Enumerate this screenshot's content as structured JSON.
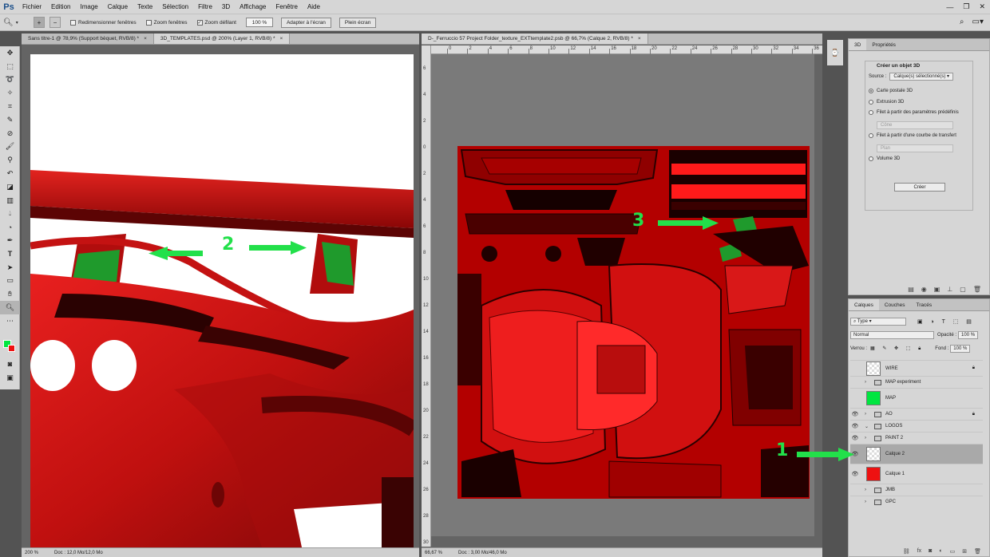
{
  "app": {
    "logo": "Ps"
  },
  "menu": [
    "Fichier",
    "Edition",
    "Image",
    "Calque",
    "Texte",
    "Sélection",
    "Filtre",
    "3D",
    "Affichage",
    "Fenêtre",
    "Aide"
  ],
  "window_controls": [
    "—",
    "❐",
    "✕"
  ],
  "options_bar": {
    "resize_windows": "Redimensionner fenêtres",
    "zoom_all": "Zoom fenêtres",
    "scrubby_zoom": "Zoom défilant",
    "zoom_value": "100 %",
    "fit_screen": "Adapter à l'écran",
    "fill_screen": "Plein écran"
  },
  "doc1": {
    "tabs": [
      "Sans titre-1 @ 78,9% (Support bèquet, RVB/8) *",
      "3D_TEMPLATES.psd @ 200% (Layer 1, RVB/8) *"
    ],
    "status_zoom": "200 %",
    "status_doc": "Doc : 12,0 Mo/12,0 Mo"
  },
  "doc2": {
    "tab": "D-_Ferruccio 57 Project Folder_texture_EXTtemplate2.psb @ 66,7% (Calque 2, RVB/8) *",
    "status_zoom": "66,67 %",
    "status_doc": "Doc : 3,00 Mo/46,0 Mo",
    "ruler_h": [
      "0",
      "2",
      "4",
      "6",
      "8",
      "10",
      "12",
      "14",
      "16",
      "18",
      "20",
      "22",
      "24",
      "26",
      "28",
      "30",
      "32",
      "34",
      "36"
    ],
    "ruler_v": [
      "6",
      "4",
      "2",
      "0",
      "2",
      "4",
      "6",
      "8",
      "10",
      "12",
      "14",
      "16",
      "18",
      "20",
      "22",
      "24",
      "26",
      "28",
      "30"
    ]
  },
  "panel3d": {
    "tabs": [
      "3D",
      "Propriétés"
    ],
    "title": "Créer un objet 3D",
    "source_label": "Source :",
    "source_value": "Calque(s) sélectionné(s)",
    "options": [
      "Carte postale 3D",
      "Extrusion 3D",
      "Filet à partir des paramètres prédéfinis",
      "Filet à partir d'une courbe de transfert",
      "Volume 3D"
    ],
    "preset_value": "Cône",
    "curve_value": "Plan",
    "create_button": "Créer"
  },
  "layers_panel": {
    "tabs": [
      "Calques",
      "Couches",
      "Tracés"
    ],
    "filter": "Type",
    "blend_mode": "Normal",
    "opacity_label": "Opacité :",
    "opacity_value": "100 %",
    "lock_label": "Verrou :",
    "fill_label": "Fond :",
    "fill_value": "100 %",
    "layers": [
      {
        "name": "WIRE",
        "kind": "layer",
        "thumb": "#eeeeee",
        "visible": false,
        "locked": true
      },
      {
        "name": "MAP experiment",
        "kind": "group",
        "visible": false,
        "locked": false
      },
      {
        "name": "MAP",
        "kind": "layer",
        "thumb": "#00e640",
        "visible": false,
        "locked": false
      },
      {
        "name": "AO",
        "kind": "group",
        "visible": true,
        "locked": true
      },
      {
        "name": "LOGOS",
        "kind": "group-open",
        "visible": true,
        "locked": false
      },
      {
        "name": "PAINT 2",
        "kind": "group",
        "visible": true,
        "locked": false
      },
      {
        "name": "Calque 2",
        "kind": "layer",
        "thumb": "#eeeeee",
        "visible": true,
        "locked": false,
        "selected": true
      },
      {
        "name": "Calque 1",
        "kind": "layer",
        "thumb": "#ee1111",
        "visible": true,
        "locked": false
      },
      {
        "name": "JMB",
        "kind": "group",
        "visible": false,
        "locked": false
      },
      {
        "name": "GPC",
        "kind": "group",
        "visible": false,
        "locked": false
      }
    ]
  },
  "annotations": [
    "1",
    "2",
    "3"
  ],
  "colors": {
    "foreground": "#00e640",
    "background": "#ee1111",
    "arrow": "#22e04a"
  }
}
